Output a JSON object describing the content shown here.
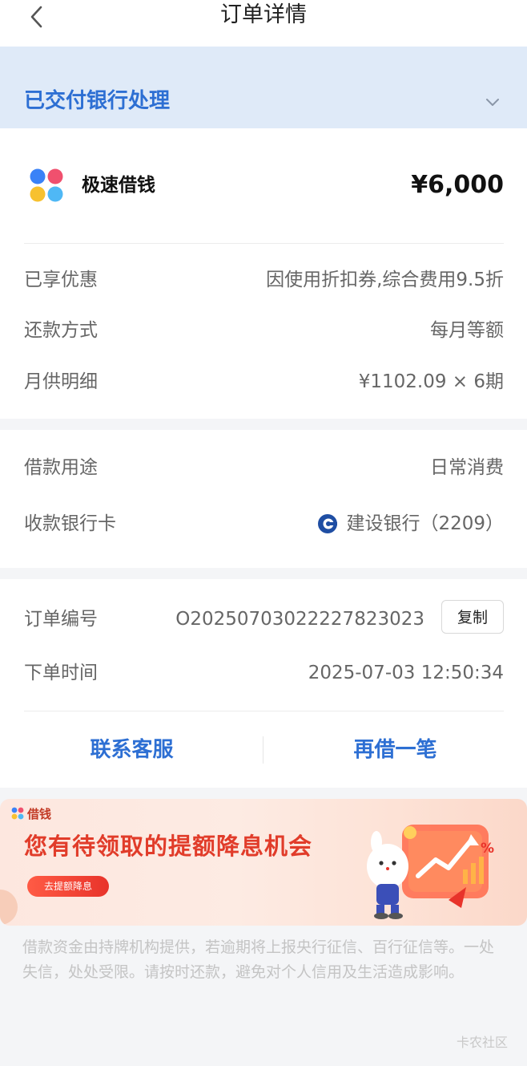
{
  "header": {
    "title": "订单详情",
    "back_icon": "chevron-left-icon"
  },
  "status": {
    "text": "已交付银行处理",
    "toggle_icon": "chevron-down-icon",
    "color": "#2d6fd3",
    "background": "#dfeaf8"
  },
  "loan": {
    "product_name": "极速借钱",
    "amount": "¥6,000",
    "discount_label": "已享优惠",
    "discount_value": "因使用折扣券,综合费用9.5折",
    "repay_label": "还款方式",
    "repay_value": "每月等额",
    "monthly_label": "月供明细",
    "monthly_value": "¥1102.09 × 6期"
  },
  "purpose": {
    "purpose_label": "借款用途",
    "purpose_value": "日常消费",
    "card_label": "收款银行卡",
    "card_value": "建设银行（2209）",
    "bank_icon": "ccb-logo-icon"
  },
  "order": {
    "number_label": "订单编号",
    "number_value": "O20250703022227823023",
    "copy_label": "复制",
    "time_label": "下单时间",
    "time_value": "2025-07-03 12:50:34"
  },
  "actions": {
    "contact_label": "联系客服",
    "borrow_again_label": "再借一笔",
    "accent": "#2d6fd3"
  },
  "banner": {
    "brand": "借钱",
    "title": "您有待领取的提额降息机会",
    "button_label": "去提额降息",
    "percent_symbol": "%"
  },
  "disclaimer": "借款资金由持牌机构提供，若逾期将上报央行征信、百行征信等。一处失信，处处受限。请按时还款，避免对个人信用及生活造成影响。",
  "watermark": "卡农社区"
}
